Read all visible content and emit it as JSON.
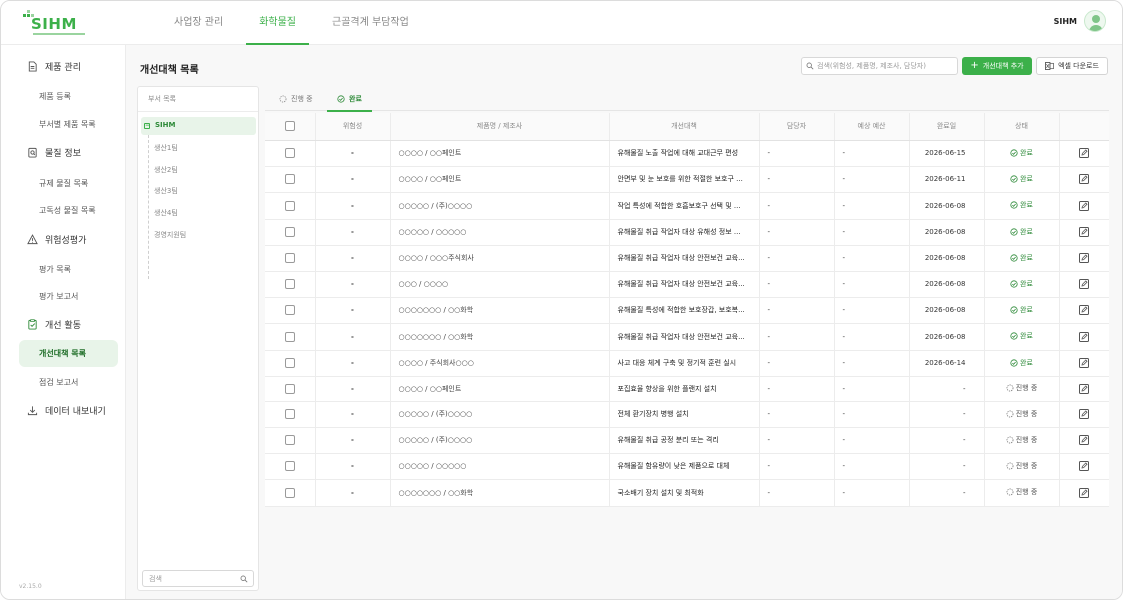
{
  "app": {
    "logo_text": "SIHM",
    "user_name": "SIHM",
    "version": "v2.15.0"
  },
  "topnav": [
    {
      "label": "사업장 관리",
      "active": false
    },
    {
      "label": "화학물질",
      "active": true
    },
    {
      "label": "근골격계 부담작업",
      "active": false
    }
  ],
  "sidebar": {
    "groups": [
      {
        "label": "제품 관리",
        "icon": "document-icon",
        "items": [
          "제품 등록",
          "부서별 제품 목록"
        ]
      },
      {
        "label": "물질 정보",
        "icon": "clipboard-search-icon",
        "items": [
          "규제 물질 목록",
          "고독성 물질 목록"
        ]
      },
      {
        "label": "위험성평가",
        "icon": "warning-icon",
        "items": [
          "평가 목록",
          "평가 보고서"
        ]
      },
      {
        "label": "개선 활동",
        "icon": "clipboard-check-icon",
        "items": [
          "개선대책 목록",
          "점검 보고서"
        ]
      },
      {
        "label": "데이터 내보내기",
        "icon": "download-icon",
        "items": []
      }
    ],
    "active_item": "개선대책 목록"
  },
  "page": {
    "title": "개선대책 목록",
    "search_placeholder": "검색(위험성, 제품명, 제조사, 담당자)",
    "add_button": "개선대책 추가",
    "excel_button": "엑셀 다운로드"
  },
  "dept": {
    "header": "부서 목록",
    "root": "SIHM",
    "children": [
      "생산1팀",
      "생산2팀",
      "생산3팀",
      "생산4팀",
      "경영지원팀"
    ],
    "search_placeholder": "검색"
  },
  "tabs": [
    {
      "label": "진행 중",
      "active": false
    },
    {
      "label": "완료",
      "active": true
    }
  ],
  "table": {
    "headers": [
      "위험성",
      "제품명 / 제조사",
      "개선대책",
      "담당자",
      "예상 예산",
      "완료일",
      "상태"
    ],
    "rows": [
      {
        "risk": "-",
        "product": "○○○○ / ○○페인트",
        "measure": "유해물질 노출 작업에 대해 교대근무 편성",
        "manager": "-",
        "budget": "-",
        "date": "2026-06-15",
        "status": "완료"
      },
      {
        "risk": "-",
        "product": "○○○○ / ○○페인트",
        "measure": "안면부 및 눈 보호를 위한 적절한 보호구 ...",
        "manager": "-",
        "budget": "-",
        "date": "2026-06-11",
        "status": "완료"
      },
      {
        "risk": "-",
        "product": "○○○○○ / (주)○○○○",
        "measure": "작업 특성에 적합한 호흡보호구 선택 및 ...",
        "manager": "-",
        "budget": "-",
        "date": "2026-06-08",
        "status": "완료"
      },
      {
        "risk": "-",
        "product": "○○○○○ / ○○○○○",
        "measure": "유해물질 취급 작업자 대상 유해성 정보 ...",
        "manager": "-",
        "budget": "-",
        "date": "2026-06-08",
        "status": "완료"
      },
      {
        "risk": "-",
        "product": "○○○○ / ○○○주식회사",
        "measure": "유해물질 취급 작업자 대상 안전보건 교육...",
        "manager": "-",
        "budget": "-",
        "date": "2026-06-08",
        "status": "완료"
      },
      {
        "risk": "-",
        "product": "○○○ / ○○○○",
        "measure": "유해물질 취급 작업자 대상 안전보건 교육...",
        "manager": "-",
        "budget": "-",
        "date": "2026-06-08",
        "status": "완료"
      },
      {
        "risk": "-",
        "product": "○○○○○○○ / ○○화학",
        "measure": "유해물질 특성에 적합한 보호장갑, 보호복...",
        "manager": "-",
        "budget": "-",
        "date": "2026-06-08",
        "status": "완료"
      },
      {
        "risk": "-",
        "product": "○○○○○○○ / ○○화학",
        "measure": "유해물질 취급 작업자 대상 안전보건 교육...",
        "manager": "-",
        "budget": "-",
        "date": "2026-06-08",
        "status": "완료"
      },
      {
        "risk": "-",
        "product": "○○○○ / 주식회사○○○",
        "measure": "사고 대응 체계 구축 및 정기적 훈련 실시",
        "manager": "-",
        "budget": "-",
        "date": "2026-06-14",
        "status": "완료"
      },
      {
        "risk": "-",
        "product": "○○○○ / ○○페인트",
        "measure": "포집효율 향상을 위한 플랜지 설치",
        "manager": "-",
        "budget": "-",
        "date": "-",
        "status": "진행 중"
      },
      {
        "risk": "-",
        "product": "○○○○○ / (주)○○○○",
        "measure": "전체 환기장치 병행 설치",
        "manager": "-",
        "budget": "-",
        "date": "-",
        "status": "진행 중"
      },
      {
        "risk": "-",
        "product": "○○○○○ / (주)○○○○",
        "measure": "유해물질 취급 공정 분리 또는 격리",
        "manager": "-",
        "budget": "-",
        "date": "-",
        "status": "진행 중"
      },
      {
        "risk": "-",
        "product": "○○○○○ / ○○○○○",
        "measure": "유해물질 함유량이 낮은 제품으로 대체",
        "manager": "-",
        "budget": "-",
        "date": "-",
        "status": "진행 중"
      },
      {
        "risk": "-",
        "product": "○○○○○○○ / ○○화학",
        "measure": "국소배기 장치 설치 및 최적화",
        "manager": "-",
        "budget": "-",
        "date": "-",
        "status": "진행 중"
      }
    ]
  },
  "colors": {
    "accent": "#3cb04a",
    "accent_bg": "#e8f4e9"
  }
}
